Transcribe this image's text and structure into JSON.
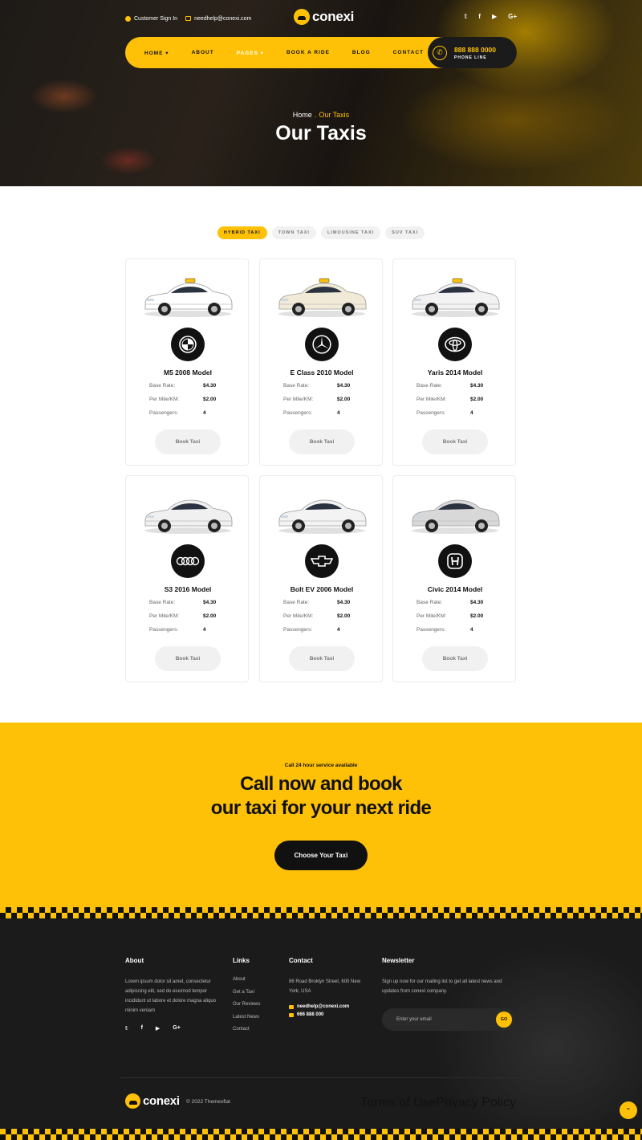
{
  "header": {
    "customer_sign_in": "Customer Sign In",
    "email": "needhelp@conexi.com",
    "logo": "conexi",
    "socials": [
      "twitter-icon",
      "facebook-icon",
      "youtube-icon",
      "google-plus-icon"
    ],
    "social_glyphs": [
      "𝕥",
      "f",
      "▶",
      "G+"
    ]
  },
  "nav": {
    "items": [
      "HOME",
      "ABOUT",
      "PAGES",
      "BOOK A RIDE",
      "BLOG",
      "CONTACT"
    ],
    "active": "PAGES",
    "phone_number": "888 888 0000",
    "phone_label": "PHONE LINE"
  },
  "hero": {
    "breadcrumb_home": "Home",
    "breadcrumb_current": "Our Taxis",
    "title": "Our Taxis"
  },
  "tabs": [
    "HYBRID TAXI",
    "TOWN TAXI",
    "LIMOUSINE TAXI",
    "SUV TAXI"
  ],
  "cards": [
    {
      "title": "M5 2008 Model",
      "brand": "bmw",
      "base_rate": "$4.30",
      "per_mile": "$2.00",
      "passengers": "4"
    },
    {
      "title": "E Class 2010 Model",
      "brand": "mercedes",
      "base_rate": "$4.30",
      "per_mile": "$2.00",
      "passengers": "4"
    },
    {
      "title": "Yaris 2014 Model",
      "brand": "toyota",
      "base_rate": "$4.30",
      "per_mile": "$2.00",
      "passengers": "4"
    },
    {
      "title": "S3 2016 Model",
      "brand": "audi",
      "base_rate": "$4.30",
      "per_mile": "$2.00",
      "passengers": "4"
    },
    {
      "title": "Bolt EV 2006 Model",
      "brand": "chevrolet",
      "base_rate": "$4.30",
      "per_mile": "$2.00",
      "passengers": "4"
    },
    {
      "title": "Civic 2014 Model",
      "brand": "honda",
      "base_rate": "$4.30",
      "per_mile": "$2.00",
      "passengers": "4"
    }
  ],
  "card_labels": {
    "base_rate": "Base Rate:",
    "per_mile": "Per Mile/KM:",
    "passengers": "Passengers:",
    "book": "Book Taxi"
  },
  "cta": {
    "subtitle": "Call 24 hour service available",
    "title_line1": "Call now and book",
    "title_line2": "our taxi for your next ride",
    "button": "Choose Your Taxi"
  },
  "footer": {
    "about_heading": "About",
    "about_text": "Lorem ipsum dolor sit amet, consectetur adipiscing elit, sed do eiusmod tempor incididunt ut labore et dolore magna aliquo minim veniam",
    "links_heading": "Links",
    "links": [
      "About",
      "Get a Taxi",
      "Our Reviews",
      "Latest News",
      "Contact"
    ],
    "contact_heading": "Contact",
    "address": "86 Road Broklyn Street, 600 New York, USA",
    "email": "needhelp@conexi.com",
    "phone": "666 888 000",
    "newsletter_heading": "Newsletter",
    "newsletter_text": "Sign up now for our mailing list to get all latest news and updates from conexi company.",
    "email_placeholder": "Enter your email",
    "go": "GO",
    "logo": "conexi",
    "copyright": "© 2022 Themesflat",
    "terms": "Terms of Use",
    "privacy": "Privacy Policy"
  },
  "colors": {
    "accent": "#ffc107",
    "dark": "#1b1b1b"
  }
}
